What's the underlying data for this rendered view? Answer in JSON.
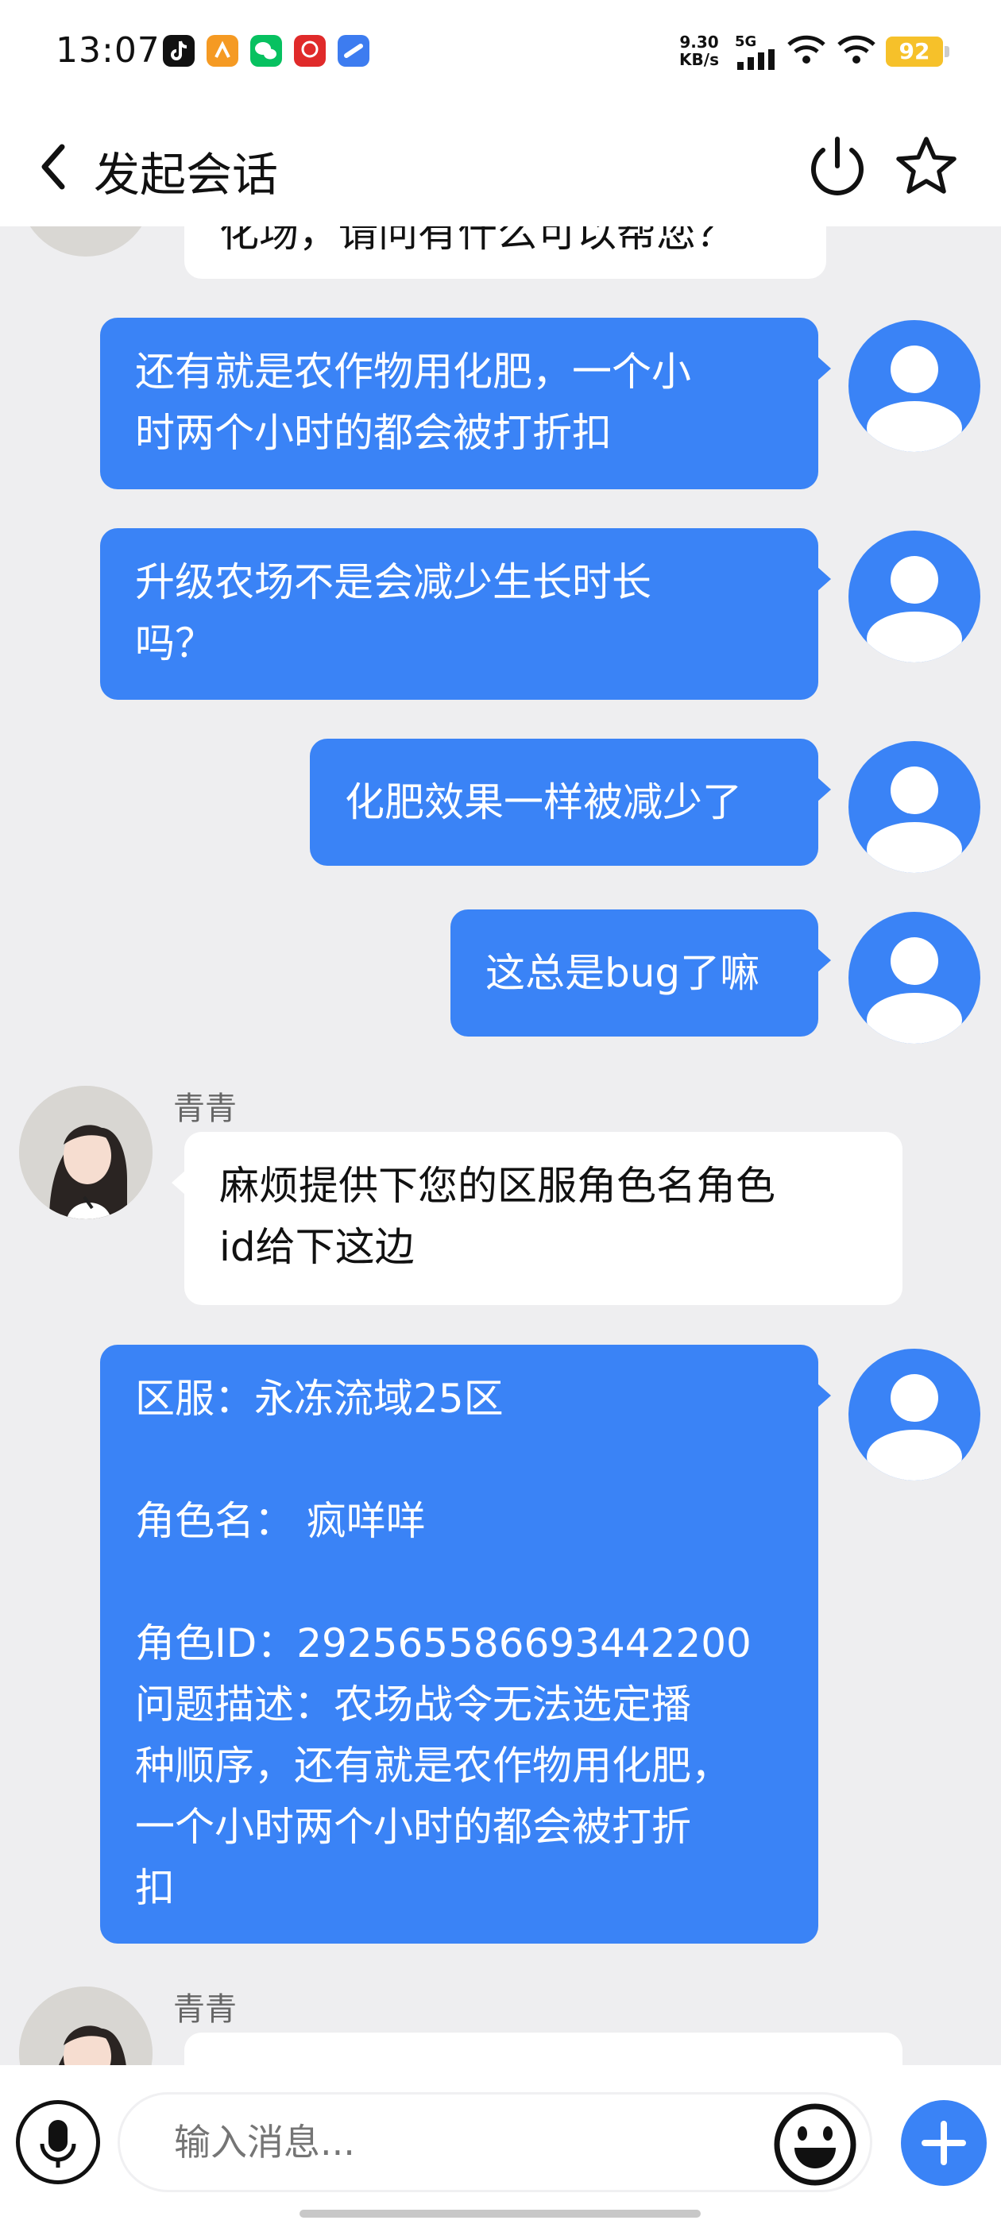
{
  "status_bar": {
    "time": "13:07",
    "net_speed": "9.30\nKB/s",
    "network": "5G",
    "battery": "92",
    "app_icons": [
      "tiktok-icon",
      "orange-app-icon",
      "wechat-icon",
      "red-app-icon",
      "blue-app-icon"
    ]
  },
  "navbar": {
    "title": "发起会话",
    "back_icon": "chevron-left-icon",
    "power_icon": "power-icon",
    "star_icon": "star-icon"
  },
  "messages": [
    {
      "from": "agent",
      "text": "化场，请问有什么可以帮您？"
    },
    {
      "from": "me",
      "text": "还有就是农作物用化肥，一个小\n时两个小时的都会被打折扣"
    },
    {
      "from": "me",
      "text": "升级农场不是会减少生长时长\n吗？"
    },
    {
      "from": "me",
      "text": "化肥效果一样被减少了"
    },
    {
      "from": "me",
      "text": "这总是bug了嘛"
    },
    {
      "from": "agent",
      "sender": "青青",
      "text": "麻烦提供下您的区服角色名角色\nid给下这边"
    },
    {
      "from": "me",
      "text": "区服：永冻流域25区\n\n角色名： 疯咩咩\n\n角色ID：292565586693442200\n问题描述：农场战令无法选定播\n种顺序，还有就是农作物用化肥，\n一个小时两个小时的都会被打折\n扣"
    },
    {
      "from": "agent",
      "sender": "青青",
      "text": ""
    }
  ],
  "input": {
    "placeholder": "输入消息..."
  },
  "colors": {
    "accent": "#3a83f6",
    "background": "#eeeef0",
    "battery": "#f6c12a"
  }
}
